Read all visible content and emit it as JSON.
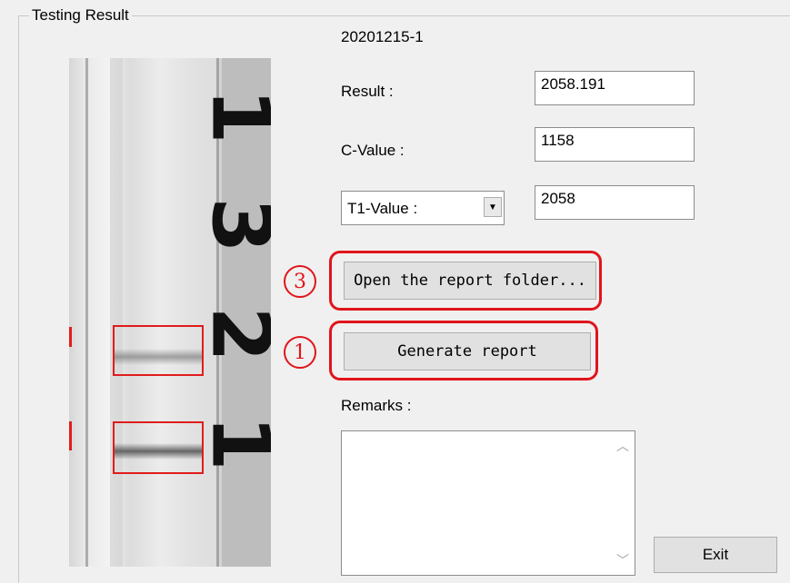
{
  "group": {
    "title": "Testing Result"
  },
  "sample_id": "20201215-1",
  "result": {
    "label": "Result :",
    "value": "2058.191"
  },
  "c_value": {
    "label": "C-Value :",
    "value": "1158"
  },
  "t_value": {
    "selected": "T1-Value :",
    "value": "2058"
  },
  "annotations": {
    "step3": "3",
    "step1": "1"
  },
  "buttons": {
    "open_folder": "Open the report folder...",
    "generate": "Generate report",
    "exit": "Exit"
  },
  "remarks": {
    "label": "Remarks :",
    "value": ""
  },
  "strip_digits": [
    "1",
    "3",
    "2",
    "1"
  ],
  "colors": {
    "annotation_red": "#e0151b",
    "roi_red": "#e01c1c",
    "background": "#f0f0f0"
  },
  "icons": {
    "dropdown": "chevron-down-icon",
    "scroll_up": "scroll-up-icon",
    "scroll_down": "scroll-down-icon"
  }
}
